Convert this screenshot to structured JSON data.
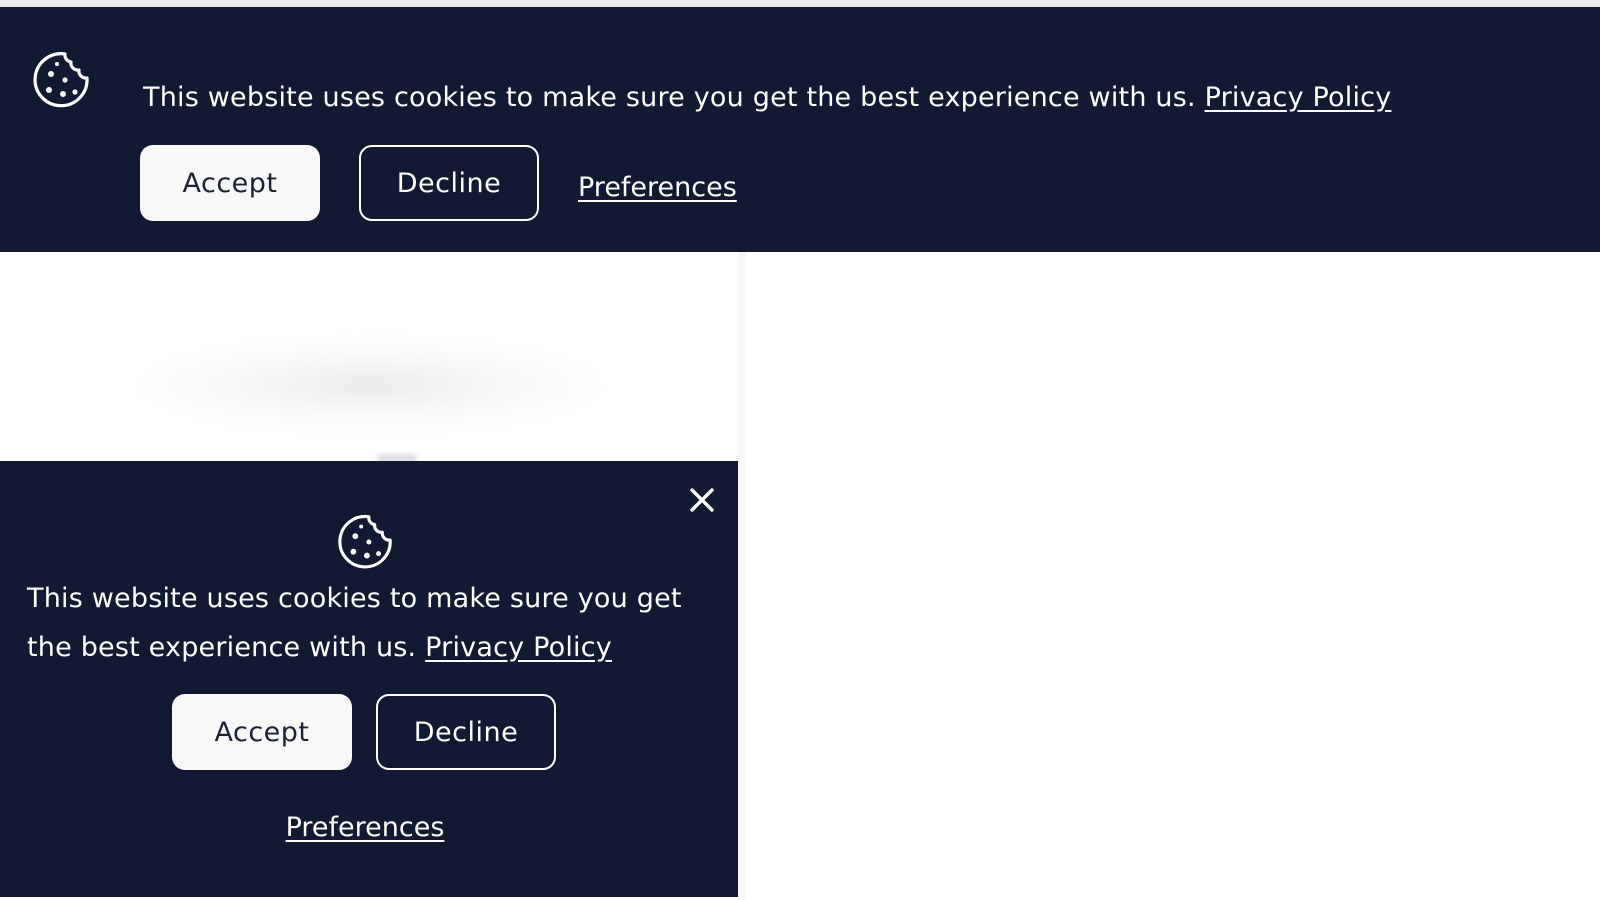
{
  "banner": {
    "message": "This website uses cookies to make sure you get the best experience with us.",
    "privacy_link": "Privacy Policy",
    "accept_label": "Accept",
    "decline_label": "Decline",
    "preferences_label": "Preferences",
    "icon": "cookie-icon"
  },
  "popup": {
    "message": "This website uses cookies to make sure you get the best experience with us.",
    "privacy_link": "Privacy Policy",
    "accept_label": "Accept",
    "decline_label": "Decline",
    "preferences_label": "Preferences",
    "icon": "cookie-icon",
    "close_icon": "close-icon"
  },
  "colors": {
    "background": "#121932",
    "text": "#ffffff",
    "accept_button": "#f8f8f8",
    "accept_text": "#1c2236"
  }
}
